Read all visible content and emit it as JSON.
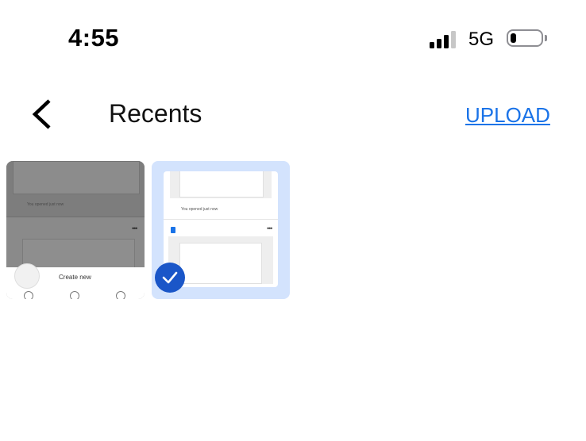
{
  "status_bar": {
    "time": "4:55",
    "network": "5G",
    "signal_icon": "cellular-signal-icon",
    "battery_icon": "battery-low-icon",
    "battery_level": 0.2
  },
  "app_bar": {
    "title": "Recents",
    "upload_label": "UPLOAD",
    "back_icon": "chevron-left-icon",
    "accent_color": "#1a73e8"
  },
  "thumbnails": [
    {
      "selected": false,
      "preview_caption": "You opened just now",
      "sheet_label": "Create new"
    },
    {
      "selected": true,
      "preview_caption": "You opened just now",
      "check_icon": "checkmark-icon",
      "selection_color": "#1a56c8"
    }
  ]
}
